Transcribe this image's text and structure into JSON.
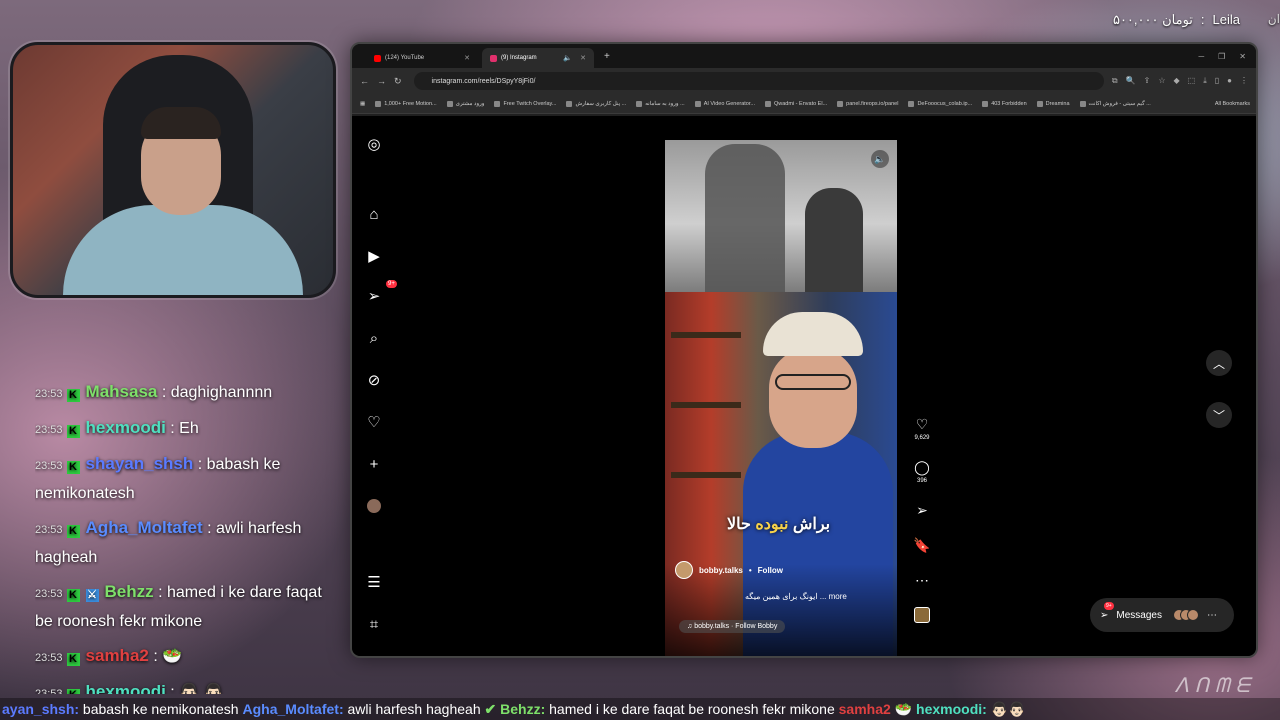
{
  "donation": {
    "amount": "۵۰۰,۰۰۰ تومان",
    "sep": ":",
    "name": "Leila",
    "edge": "ان"
  },
  "colors": {
    "accent": "#ff3040",
    "ig_bg": "#000000",
    "chat_badge": "#2ecc40"
  },
  "chat": [
    {
      "time": "23:53",
      "badge": "K",
      "user": "Mahsasa",
      "user_color": "#7ee06a",
      "msg": ": daghighannnn"
    },
    {
      "time": "23:53",
      "badge": "K",
      "user": "hexmoodi",
      "user_color": "#4fe0c0",
      "msg": ": Eh"
    },
    {
      "time": "23:53",
      "badge": "K",
      "user": "shayan_shsh",
      "user_color": "#5b7bff",
      "msg": ": babash ke nemikonatesh"
    },
    {
      "time": "23:53",
      "badge": "K",
      "user": "Agha_Moltafet",
      "user_color": "#5a8cff",
      "msg": ": awli harfesh hagheah"
    },
    {
      "time": "23:53",
      "badge": "K",
      "user": "Behzz",
      "user_color": "#7ee06a",
      "msg": ": hamed i ke dare faqat be roonesh fekr mikone"
    },
    {
      "time": "23:53",
      "badge": "K",
      "user": "samha2",
      "user_color": "#e04040",
      "msg": ": 🥗"
    },
    {
      "time": "23:53",
      "badge": "K",
      "user": "hexmoodi",
      "user_color": "#4fe0c0",
      "msg": ": 👨🏻 👨🏻"
    }
  ],
  "browser": {
    "tabs": [
      {
        "label": "(124) YouTube",
        "color": "#ff0000"
      },
      {
        "label": "(9) Instagram",
        "color": "#e1306c"
      }
    ],
    "url": "instagram.com/reels/DSpyY8jFi0/",
    "bookmarks": [
      "1,000+ Free Motion...",
      "ورود مشتری",
      "Free Twitch Overlay...",
      "پنل کاربری سفارش ...",
      "ورود به سامانه ...",
      "AI Video Generator...",
      "Qwadmi - Envato El...",
      "panel.fireops.io/panel",
      "DeFooocus_colab.ip...",
      "403 Forbidden",
      "Dreamina",
      "گیم سیتی - فروش اکانت ..."
    ],
    "all_bookmarks": "All Bookmarks"
  },
  "instagram": {
    "sidebar_badge": "9+",
    "reel": {
      "subtitle_white": "براش ",
      "subtitle_yellow": "نبوده",
      "subtitle_end": " حالا",
      "author": "bobby.talks",
      "dot": "•",
      "follow": "Follow",
      "caption": "ایونگ برای همین میگه ... more",
      "audio": "♫ bobby.talks · Follow Bobby"
    },
    "likes": "9,629",
    "comments": "396",
    "messages_label": "Messages",
    "messages_badge": "9+"
  },
  "ticker": [
    {
      "user": "ayan_shsh:",
      "color": "#5b7bff",
      "msg": " babash ke nemikonatesh "
    },
    {
      "user": "Agha_Moltafet:",
      "color": "#5a8cff",
      "msg": " awli harfesh hagheah "
    },
    {
      "user": "✔ Behzz:",
      "color": "#7ee06a",
      "msg": " hamed i ke dare faqat be roonesh fekr mikone "
    },
    {
      "user": "samha2",
      "color": "#e04040",
      "msg": " 🥗 "
    },
    {
      "user": "hexmoodi:",
      "color": "#4fe0c0",
      "msg": " 👨🏻👨🏻"
    }
  ]
}
